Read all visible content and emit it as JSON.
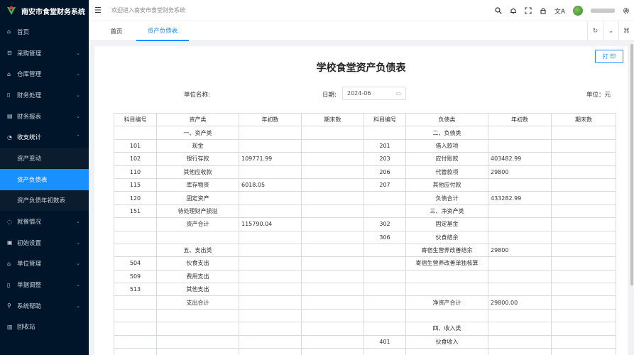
{
  "app": {
    "title": "南安市食堂财务系统",
    "welcome": "欢迎进入南安市食堂财务系统"
  },
  "sidebar": {
    "items": [
      {
        "label": "首页",
        "icon": "home-icon",
        "glyph": "⌂"
      },
      {
        "label": "采购管理",
        "icon": "cart-icon",
        "glyph": "⊟"
      },
      {
        "label": "仓库管理",
        "icon": "warehouse-icon",
        "glyph": "⌂"
      },
      {
        "label": "财务处理",
        "icon": "document-icon",
        "glyph": "▯"
      },
      {
        "label": "财务报表",
        "icon": "report-icon",
        "glyph": "▤"
      },
      {
        "label": "收支统计",
        "icon": "pie-chart-icon",
        "glyph": "◔"
      },
      {
        "label": "就餐情况",
        "icon": "dining-icon",
        "glyph": "◌"
      },
      {
        "label": "初始设置",
        "icon": "settings-icon",
        "glyph": "▣"
      },
      {
        "label": "单位管理",
        "icon": "building-icon",
        "glyph": "⌂"
      },
      {
        "label": "单据调整",
        "icon": "receipt-icon",
        "glyph": "▯"
      },
      {
        "label": "系统帮助",
        "icon": "help-icon",
        "glyph": "⚲"
      },
      {
        "label": "回收站",
        "icon": "trash-icon",
        "glyph": "▥"
      }
    ],
    "submenu": [
      {
        "label": "资产变动"
      },
      {
        "label": "资产负债表"
      },
      {
        "label": "资产负债年初数表"
      }
    ]
  },
  "tabs": [
    {
      "label": "首页"
    },
    {
      "label": "资产负债表"
    }
  ],
  "report": {
    "title": "学校食堂资产负债表",
    "print": "打 印",
    "unit_name_label": "单位名称:",
    "date_label": "日期:",
    "date_value": "2024-06",
    "currency_label": "单位：元",
    "headers": [
      "科目编号",
      "资产类",
      "年初数",
      "期末数",
      "科目编号",
      "负债类",
      "年初数",
      "期末数"
    ],
    "rows": [
      [
        "",
        "一、资产类",
        "",
        "",
        "",
        "二、负债类",
        "",
        ""
      ],
      [
        "101",
        "现金",
        "",
        "",
        "201",
        "借入款项",
        "",
        ""
      ],
      [
        "102",
        "银行存款",
        "109771.99",
        "",
        "203",
        "应付账款",
        "403482.99",
        ""
      ],
      [
        "110",
        "其他应收款",
        "",
        "",
        "206",
        "代管款项",
        "29800",
        ""
      ],
      [
        "115",
        "库存物资",
        "6018.05",
        "",
        "207",
        "其他应付款",
        "",
        ""
      ],
      [
        "120",
        "固定资产",
        "",
        "",
        "",
        "负债合计",
        "433282.99",
        ""
      ],
      [
        "151",
        "待处理财产损溢",
        "",
        "",
        "",
        "三、净资产类",
        "",
        ""
      ],
      [
        "",
        "资产合计",
        "115790.04",
        "",
        "302",
        "固定基金",
        "",
        ""
      ],
      [
        "",
        "",
        "",
        "",
        "306",
        "伙食结余",
        "",
        ""
      ],
      [
        "",
        "五、支出类",
        "",
        "",
        "",
        "寄宿生营养改善结余",
        "29800",
        ""
      ],
      [
        "504",
        "伙食支出",
        "",
        "",
        "",
        "寄宿生营养改善单独核算",
        "",
        ""
      ],
      [
        "509",
        "费用支出",
        "",
        "",
        "",
        "",
        "",
        ""
      ],
      [
        "513",
        "其他支出",
        "",
        "",
        "",
        "",
        "",
        ""
      ],
      [
        "",
        "支出合计",
        "",
        "",
        "",
        "净资产合计",
        "29800.00",
        ""
      ],
      [
        "",
        "",
        "",
        "",
        "",
        "",
        "",
        ""
      ],
      [
        "",
        "",
        "",
        "",
        "",
        "四、收入类",
        "",
        ""
      ],
      [
        "",
        "",
        "",
        "",
        "401",
        "伙食收入",
        "",
        ""
      ],
      [
        "",
        "",
        "",
        "",
        "",
        "",
        "",
        ""
      ]
    ]
  },
  "colors": {
    "sidebar_bg": "#001529",
    "accent": "#1890ff"
  }
}
